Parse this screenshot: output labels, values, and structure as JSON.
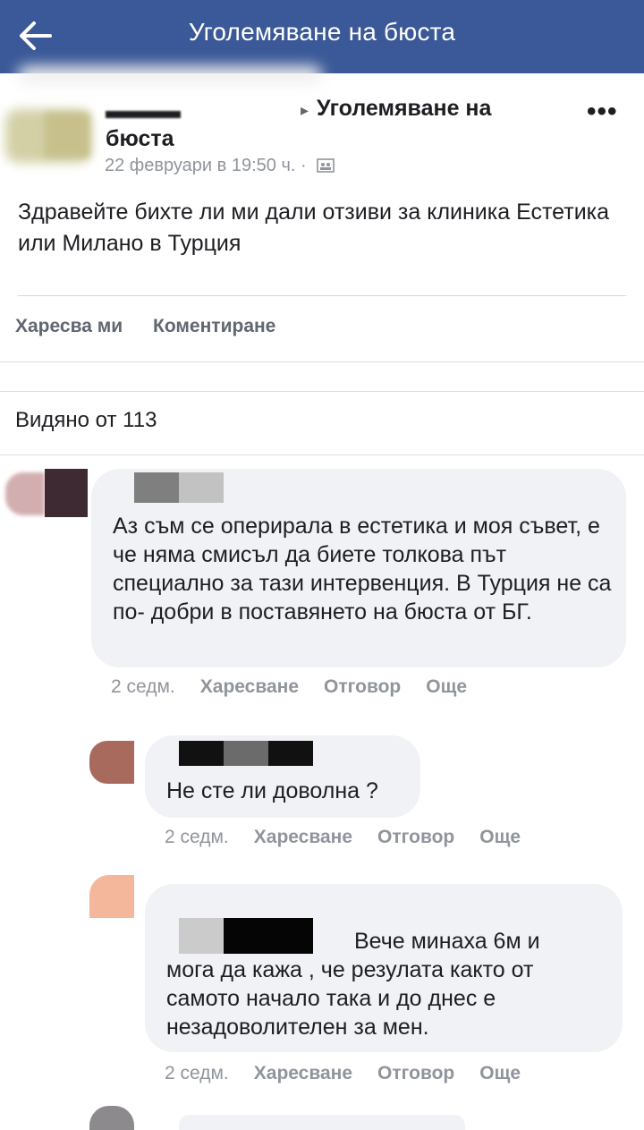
{
  "header": {
    "title": "Уголемяване на бюста"
  },
  "post": {
    "group_name_part1": "Уголемяване на",
    "group_name_part2": "бюста",
    "date": "22 февруари в 19:50 ч. ·",
    "text": "Здравейте бихте ли ми дали отзиви за клиника Естетика или Милано в Турция",
    "like_label": "Харесва ми",
    "comment_label": "Коментиране",
    "seen_by": "Видяно от 113"
  },
  "comments": [
    {
      "text": "Аз съм се оперирала в естетика и моя съвет, е че няма смисъл да биете толкова път специално за тази интервенция. В Турция не са по- добри в поставянето на бюста от БГ.",
      "time": "2 седм.",
      "like": "Харесване",
      "reply": "Отговор",
      "more": "Още"
    },
    {
      "text": "Не сте ли доволна ?",
      "time": "2 седм.",
      "like": "Харесване",
      "reply": "Отговор",
      "more": "Още"
    },
    {
      "text_line1": "Вече минаха 6м и",
      "text_rest": "мога да кажа , че резулата както от самото начало така и до днес е незадоволителен за мен.",
      "time": "2 седм.",
      "like": "Харесване",
      "reply": "Отговор",
      "more": "Още"
    }
  ],
  "colors": {
    "header_bg": "#3b5998",
    "bubble_bg": "#f0f2f5",
    "meta_gray": "#90949c"
  },
  "icons": {
    "back": "arrow-left-icon",
    "more": "more-dots-icon",
    "audience": "group-audience-icon"
  }
}
